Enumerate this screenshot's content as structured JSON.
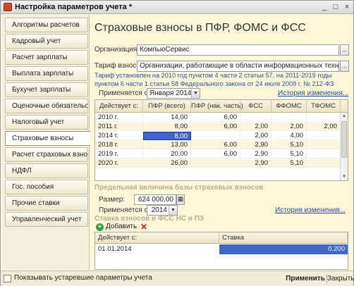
{
  "window": {
    "title": "Настройка параметров учета *",
    "btn_minimize": "_",
    "btn_maximize": "□",
    "btn_close": "×"
  },
  "sidebar": {
    "items": [
      {
        "label": "Алгоритмы расчетов"
      },
      {
        "label": "Кадровый учет"
      },
      {
        "label": "Расчет зарплаты"
      },
      {
        "label": "Выплата зарплаты"
      },
      {
        "label": "Бухучет зарплаты"
      },
      {
        "label": "Оценочные обязательства"
      },
      {
        "label": "Налоговый учет"
      },
      {
        "label": "Страховые взносы"
      },
      {
        "label": "Расчет страховых взносов"
      },
      {
        "label": "НДФЛ"
      },
      {
        "label": "Гос. пособия"
      },
      {
        "label": "Прочие ставки"
      },
      {
        "label": "Управленческий учет"
      }
    ],
    "active_index": 7
  },
  "main": {
    "title": "Страховые взносы в ПФР, ФОМС и ФСС",
    "organization_label": "Организация:",
    "organization_value": "КомпьюСервис",
    "tariff_label": "Тариф взносов:",
    "tariff_value": "Организации, работающие в области информационных технологий",
    "dots": "...",
    "tariff_info": "Тариф установлен на 2010 год пунктом 4 части 2 статьи 57, на 2011-2019 годы пунктом 6 части 1 статьи 58 Федерального закона от 24 июля 2009 г. № 212-ФЗ",
    "applied_label": "Применяется с:",
    "applied_value": "Января 2014",
    "history_link": "История изменения..."
  },
  "rates_table": {
    "columns": [
      "Действует с:",
      "ПФР (всего)",
      "ПФР (нак. часть)",
      "ФСС",
      "ФФОМС",
      "ТФОМС"
    ],
    "rows": [
      [
        "2010 г.",
        "14,00",
        "6,00",
        "",
        "",
        ""
      ],
      [
        "2011 г.",
        "8,00",
        "6,00",
        "2,00",
        "2,00",
        "2,00"
      ],
      [
        "2014 г.",
        "8,00",
        "",
        "2,00",
        "4,00",
        ""
      ],
      [
        "2018 г.",
        "13,00",
        "6,00",
        "2,90",
        "5,10",
        ""
      ],
      [
        "2019 г.",
        "20,00",
        "6,00",
        "2,90",
        "5,10",
        ""
      ],
      [
        "2020 г.",
        "26,00",
        "",
        "2,90",
        "5,10",
        ""
      ]
    ],
    "selected_row": 2,
    "selected_col": 1
  },
  "base_section": {
    "heading": "Предельная величина базы страховых взносов",
    "size_label": "Размер:",
    "size_value": "624 000,00",
    "applied_label": "Применяется с:",
    "applied_value": "2014",
    "history_link": "История изменения..."
  },
  "ns_section": {
    "heading": "Ставка взносов в ФСС НС и ПЗ",
    "add_label": "Добавить",
    "columns": [
      "Действует с:",
      "Ставка"
    ],
    "rows": [
      [
        "01.01.2014",
        "0,200"
      ]
    ]
  },
  "footer": {
    "show_obsolete_label": "Показывать устаревшие параметры учета",
    "apply_label": "Применить",
    "close_label": "Закрыть"
  }
}
